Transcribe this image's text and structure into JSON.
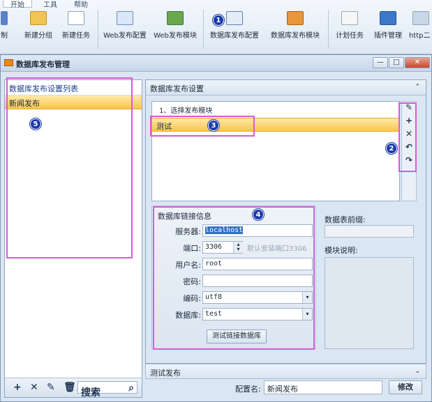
{
  "ribbon": {
    "tabs": [
      "开始",
      "工具",
      "帮助"
    ],
    "buttons": [
      "新建分组",
      "新建任务",
      "Web发布配置",
      "Web发布模块",
      "数据库发布配置",
      "数据库发布模块",
      "计划任务",
      "插件管理",
      "http二"
    ],
    "left_fragment": "制"
  },
  "window": {
    "title": "数据库发布管理",
    "min": "—",
    "max": "□",
    "close": "✕"
  },
  "left_panel": {
    "header": "数据库发布设置列表",
    "items": [
      "新闻发布"
    ],
    "search_placeholder": "搜索"
  },
  "right_panel": {
    "header": "数据库发布设置",
    "module_list_title": "1、选择发布模块",
    "modules": [
      "测试"
    ],
    "db": {
      "caption": "数据库链接信息",
      "server_label": "服务器:",
      "server_value": "localhost",
      "port_label": "端口:",
      "port_value": "3306",
      "port_hint": "默认安装端口3306",
      "user_label": "用户名:",
      "user_value": "root",
      "password_label": "密码:",
      "password_value": "",
      "encoding_label": "编码:",
      "encoding_value": "utf8",
      "database_label": "数据库:",
      "database_value": "test",
      "test_button": "测试链接数据库"
    },
    "prefix_label": "数据表前缀:",
    "module_desc_label": "模块说明:"
  },
  "bottom": {
    "section": "测试发布",
    "config_label": "配置名:",
    "config_value": "新闻发布",
    "modify_button": "修改"
  },
  "annotations": [
    "1",
    "2",
    "3",
    "4",
    "5"
  ],
  "colors": {
    "annotation": "#d65bd6",
    "badge": "#1b3aa8",
    "selection": "#f9c54d"
  }
}
